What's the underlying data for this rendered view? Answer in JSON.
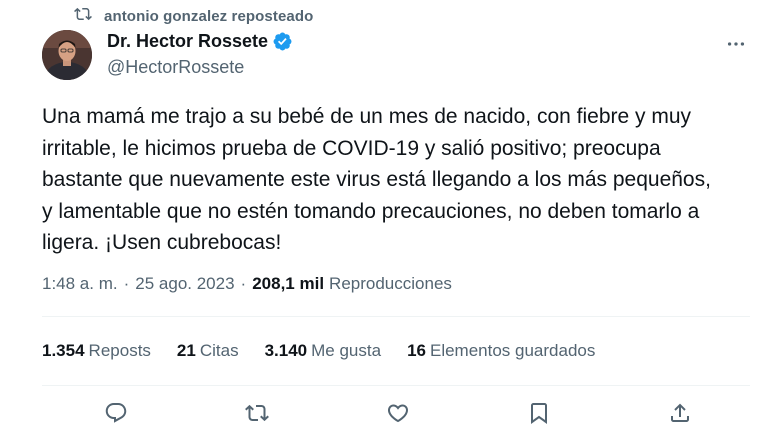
{
  "repost": {
    "icon": "repost-icon",
    "text": "antonio gonzalez reposteado"
  },
  "author": {
    "name": "Dr. Hector Rossete",
    "handle": "@HectorRossete",
    "verified": true,
    "verified_color": "#1d9bf0"
  },
  "tweet": {
    "text": "Una mamá me trajo a su bebé de un mes de nacido, con fiebre y muy\nirritable, le hicimos prueba de COVID-19 y salió positivo; preocupa\nbastante que nuevamente este virus está llegando a los más pequeños,\ny lamentable que no estén tomando precauciones, no deben tomarlo a\nligera. ¡Usen cubrebocas!"
  },
  "meta": {
    "time": "1:48 a. m.",
    "separator": "·",
    "date": "25 ago. 2023",
    "views_count": "208,1 mil",
    "views_label": "Reproducciones"
  },
  "stats": [
    {
      "count": "1.354",
      "label": "Reposts"
    },
    {
      "count": "21",
      "label": "Citas"
    },
    {
      "count": "3.140",
      "label": "Me gusta"
    },
    {
      "count": "16",
      "label": "Elementos guardados"
    }
  ],
  "actions": [
    "reply-icon",
    "repost-icon",
    "like-icon",
    "bookmark-icon",
    "share-icon"
  ],
  "colors": {
    "text": "#0f1419",
    "secondary": "#536471",
    "divider": "#eff3f4",
    "accent": "#1d9bf0"
  }
}
